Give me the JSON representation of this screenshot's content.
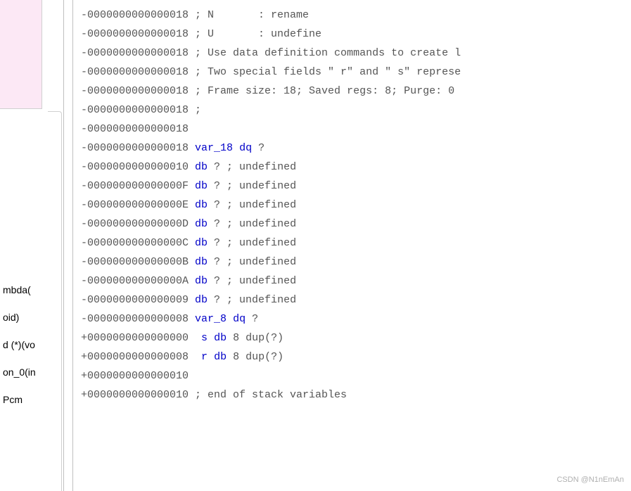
{
  "left_panel": {
    "items": [
      "mbda(",
      "oid)",
      "d (*)(vo",
      "on_0(in",
      "Pcm"
    ]
  },
  "lines": [
    {
      "offset": "-0000000000000018",
      "pre": " ; N       : rename"
    },
    {
      "offset": "-0000000000000018",
      "pre": " ; U       : undefine"
    },
    {
      "offset": "-0000000000000018",
      "pre": " ; Use data definition commands to create l"
    },
    {
      "offset": "-0000000000000018",
      "pre": " ; Two special fields \" r\" and \" s\" represe"
    },
    {
      "offset": "-0000000000000018",
      "pre": " ; Frame size: 18; Saved regs: 8; Purge: 0"
    },
    {
      "offset": "-0000000000000018",
      "pre": " ;"
    },
    {
      "offset": "-0000000000000018",
      "pre": ""
    },
    {
      "offset": "-0000000000000018",
      "var": "var_18",
      "kw": "dq",
      "post": " ?"
    },
    {
      "offset": "-0000000000000010",
      "kw": "db",
      "post": " ? ; undefined"
    },
    {
      "offset": "-000000000000000F",
      "kw": "db",
      "post": " ? ; undefined"
    },
    {
      "offset": "-000000000000000E",
      "kw": "db",
      "post": " ? ; undefined"
    },
    {
      "offset": "-000000000000000D",
      "kw": "db",
      "post": " ? ; undefined"
    },
    {
      "offset": "-000000000000000C",
      "kw": "db",
      "post": " ? ; undefined"
    },
    {
      "offset": "-000000000000000B",
      "kw": "db",
      "post": " ? ; undefined"
    },
    {
      "offset": "-000000000000000A",
      "kw": "db",
      "post": " ? ; undefined"
    },
    {
      "offset": "-0000000000000009",
      "kw": "db",
      "post": " ? ; undefined"
    },
    {
      "offset": "-0000000000000008",
      "var": "var_8",
      "kw": "dq",
      "post": " ?"
    },
    {
      "offset": "+0000000000000000",
      "var": " s",
      "kw": "db",
      "post": " 8 dup(?)"
    },
    {
      "offset": "+0000000000000008",
      "var": " r",
      "kw": "db",
      "post": " 8 dup(?)"
    },
    {
      "offset": "+0000000000000010",
      "pre": ""
    },
    {
      "offset": "+0000000000000010",
      "pre": " ; end of stack variables"
    }
  ],
  "watermark": "CSDN @N1nEmAn"
}
